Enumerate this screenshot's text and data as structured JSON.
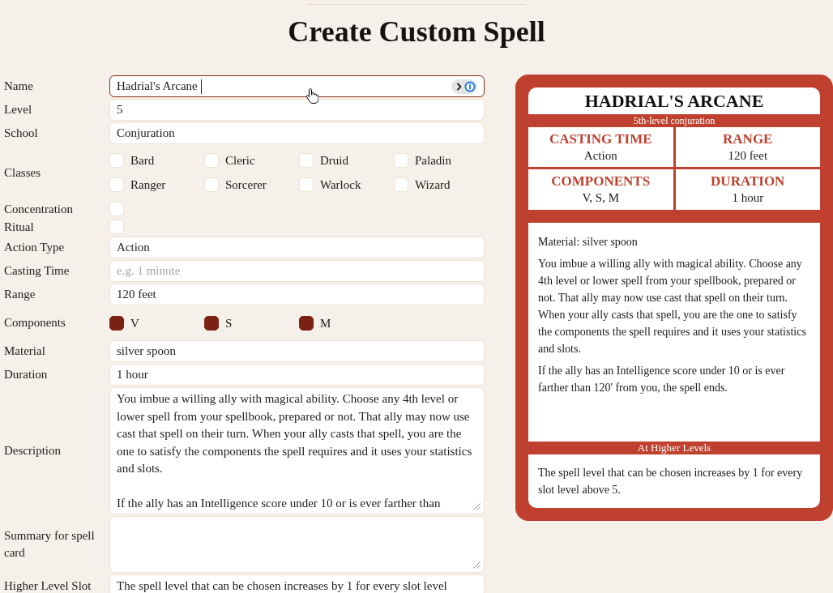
{
  "title": "Create Custom Spell",
  "form": {
    "rows": [
      {
        "kind": "text",
        "label": "Name",
        "value": "Hadrial's Arcane",
        "focused": true
      },
      {
        "kind": "text",
        "label": "Level",
        "value": "5",
        "focused": false
      },
      {
        "kind": "text",
        "label": "School",
        "value": "Conjuration",
        "focused": false
      },
      {
        "kind": "options",
        "label": "Classes",
        "options": [
          {
            "label": "Bard",
            "checked": false
          },
          {
            "label": "Cleric",
            "checked": false
          },
          {
            "label": "Druid",
            "checked": false
          },
          {
            "label": "Paladin",
            "checked": false
          },
          {
            "label": "Ranger",
            "checked": false
          },
          {
            "label": "Sorcerer",
            "checked": false
          },
          {
            "label": "Warlock",
            "checked": false
          },
          {
            "label": "Wizard",
            "checked": false
          }
        ]
      },
      {
        "kind": "checkbox",
        "label": "Concentration",
        "checked": false
      },
      {
        "kind": "checkbox",
        "label": "Ritual",
        "checked": false
      },
      {
        "kind": "text",
        "label": "Action Type",
        "value": "Action",
        "focused": false
      },
      {
        "kind": "text",
        "label": "Casting Time",
        "placeholder": "e.g. 1 minute",
        "focused": false
      },
      {
        "kind": "text",
        "label": "Range",
        "value": "120 feet",
        "focused": false
      },
      {
        "kind": "options",
        "label": "Components",
        "options": [
          {
            "label": "V",
            "checked": true
          },
          {
            "label": "S",
            "checked": true
          },
          {
            "label": "M",
            "checked": true
          }
        ]
      },
      {
        "kind": "text",
        "label": "Material",
        "value": "silver spoon",
        "focused": false
      },
      {
        "kind": "text",
        "label": "Duration",
        "value": "1 hour",
        "focused": false
      },
      {
        "kind": "textarea",
        "label": "Description",
        "value": "You imbue a willing ally with magical ability. Choose any 4th level or lower spell from your spellbook, prepared or not. That ally may now use cast that spell on their turn. When your ally casts that spell, you are the one to satisfy the components the spell requires and it uses your statistics and slots.\n\nIf the ally has an Intelligence score under 10 or is ever farther than"
      },
      {
        "kind": "textarea",
        "label": "Summary for spell card"
      },
      {
        "kind": "textarea",
        "label": "Higher Level Slot",
        "value": "The spell level that can be chosen increases by 1 for every slot level"
      }
    ]
  },
  "spell_card": {
    "title": "HADRIAL'S ARCANE",
    "subtitle": "5th-level conjuration",
    "stats": [
      {
        "label": "CASTING TIME",
        "value": "Action"
      },
      {
        "label": "RANGE",
        "value": "120 feet"
      },
      {
        "label": "COMPONENTS",
        "value": "V, S, M"
      },
      {
        "label": "DURATION",
        "value": "1 hour"
      }
    ],
    "body": [
      "Material: silver spoon",
      "You imbue a willing ally with magical ability. Choose any 4th level or lower spell from your spellbook, prepared or not. That ally may now use cast that spell on their turn. When your ally casts that spell, you are the one to satisfy the components the spell requires and it uses your statistics and slots.",
      "If the ally has an Intelligence score under 10 or is ever farther than 120' from you, the spell ends."
    ],
    "higher_levels": {
      "heading": "At Higher Levels",
      "text": "The spell level that can be chosen increases by 1 for every slot level above 5."
    }
  }
}
